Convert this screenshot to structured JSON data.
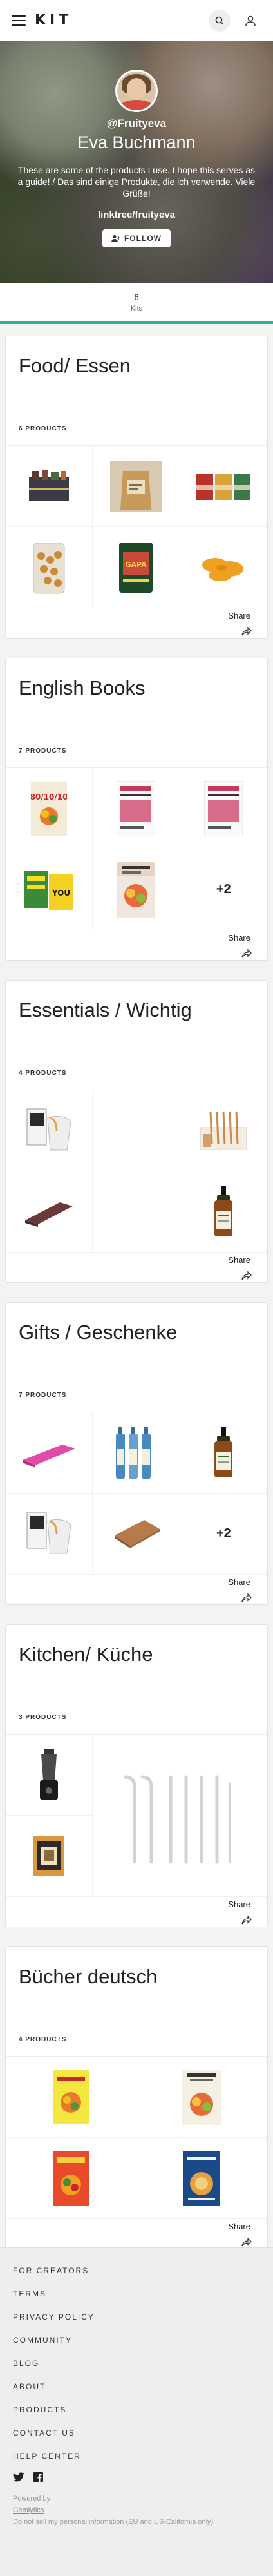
{
  "header": {
    "logo": "KIT"
  },
  "profile": {
    "handle": "@Fruityeva",
    "name": "Eva Buchmann",
    "bio": "These are some of the products I use. I hope this serves as a guide! / Das sind einige Produkte, die ich verwende. Viele Grüße!",
    "link": "linktree/fruityeva",
    "follow_label": "FOLLOW"
  },
  "kits_summary": {
    "count": "6",
    "label": "Kits"
  },
  "kits": [
    {
      "title": "Food/ Essen",
      "count_label": "6 PRODUCTS",
      "share_label": "Share",
      "more": ""
    },
    {
      "title": "English Books",
      "count_label": "7 PRODUCTS",
      "share_label": "Share",
      "more": "+2"
    },
    {
      "title": "Essentials / Wichtig",
      "count_label": "4 PRODUCTS",
      "share_label": "Share",
      "more": ""
    },
    {
      "title": "Gifts / Geschenke",
      "count_label": "7 PRODUCTS",
      "share_label": "Share",
      "more": "+2"
    },
    {
      "title": "Kitchen/ Küche",
      "count_label": "3 PRODUCTS",
      "share_label": "Share",
      "more": ""
    },
    {
      "title": "Bücher deutsch",
      "count_label": "4 PRODUCTS",
      "share_label": "Share",
      "more": ""
    }
  ],
  "footer": {
    "links": [
      "FOR CREATORS",
      "TERMS",
      "PRIVACY POLICY",
      "COMMUNITY",
      "BLOG",
      "ABOUT",
      "PRODUCTS",
      "CONTACT US",
      "HELP CENTER"
    ],
    "powered_by": "Powered by",
    "powered_link": "Gemlytics",
    "privacy_note": "Do not sell my personal information (EU and US-California only)"
  },
  "colors": {
    "accent": "#2bb596",
    "hero_overlay": "#000000"
  },
  "icons": [
    "hamburger-icon",
    "search-icon",
    "user-icon",
    "person-plus-icon",
    "share-arrow-icon",
    "twitter-icon",
    "facebook-icon"
  ]
}
